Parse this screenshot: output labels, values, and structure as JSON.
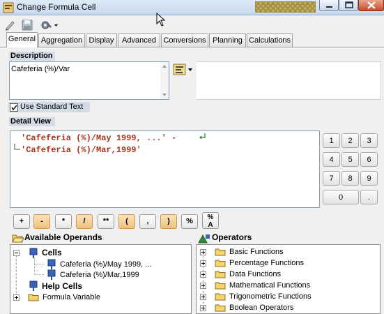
{
  "window": {
    "title": "Change Formula Cell",
    "colors": {
      "titlebar": "#dfeaf7",
      "section_bg": "#d3dbe6",
      "formula_text": "#a8341c",
      "close_button": "#c64b2b",
      "op_orange": "#efc07c"
    }
  },
  "toolbar": {
    "icons": [
      "edit-pen-icon",
      "save-disk-icon",
      "settings-wrench-icon"
    ]
  },
  "tabs": [
    {
      "label": "General",
      "active": true
    },
    {
      "label": "Aggregation"
    },
    {
      "label": "Display"
    },
    {
      "label": "Advanced"
    },
    {
      "label": "Conversions"
    },
    {
      "label": "Planning"
    },
    {
      "label": "Calculations"
    }
  ],
  "description": {
    "header": "Description",
    "value": "Cafeferia (%)/Var"
  },
  "use_standard_text": {
    "label": "Use Standard Text",
    "checked": true
  },
  "detail_view": {
    "header": "Detail View",
    "line1": "'Cafeferia (%)/May 1999, ...' -",
    "line2": "'Cafeferia (%)/Mar,1999'"
  },
  "keypad": [
    "1",
    "2",
    "3",
    "4",
    "5",
    "6",
    "7",
    "8",
    "9",
    "0",
    "."
  ],
  "operators_row": [
    "+",
    "-",
    "*",
    "/",
    "**",
    "(",
    ",",
    ")",
    "%",
    "%A"
  ],
  "available_operands": {
    "header": "Available Operands",
    "cells_label": "Cells",
    "cell_items": [
      "Cafeferia (%)/May 1999, ...",
      "Cafeferia (%)/Mar,1999"
    ],
    "help_cells_label": "Help Cells",
    "formula_variable_label": "Formula Variable"
  },
  "operators_panel": {
    "header": "Operators",
    "items": [
      "Basic Functions",
      "Percentage Functions",
      "Data Functions",
      "Mathematical Functions",
      "Trigonometric Functions",
      "Boolean Operators"
    ]
  }
}
